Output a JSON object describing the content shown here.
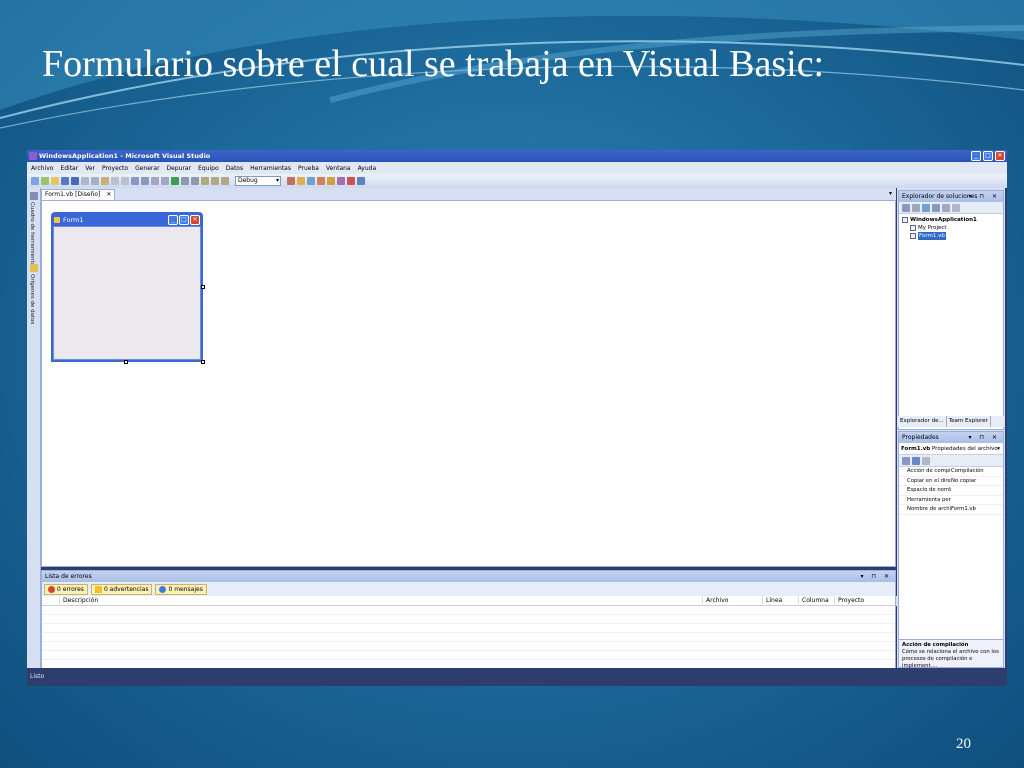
{
  "slide": {
    "title": "Formulario sobre el cual se trabaja en Visual Basic:",
    "page_number": "20"
  },
  "vs": {
    "window_title": "WindowsApplication1 - Microsoft Visual Studio",
    "window_buttons": [
      "_",
      "□",
      "✕"
    ],
    "menu": [
      "Archivo",
      "Editar",
      "Ver",
      "Proyecto",
      "Generar",
      "Depurar",
      "Equipo",
      "Datos",
      "Herramientas",
      "Prueba",
      "Ventana",
      "Ayuda"
    ],
    "config_value": "Debug",
    "left_strip": {
      "toolbox": "Cuadro de herramientas",
      "datasources": "Orígenes de datos"
    },
    "doc_tab": {
      "label": "Form1.vb [Diseño]",
      "close": "✕"
    },
    "form": {
      "title": "Form1"
    },
    "error_list": {
      "title": "Lista de errores",
      "controls": "▾ ⊓ ✕",
      "filters": [
        "0 errores",
        "0 advertencias",
        "0 mensajes"
      ],
      "columns": [
        "",
        "Descripción",
        "Archivo",
        "Línea",
        "Columna",
        "Proyecto"
      ]
    },
    "solution_explorer": {
      "title": "Explorador de soluciones",
      "controls": "▾ ⊓ ✕",
      "items": [
        "WindowsApplication1",
        "My Project",
        "Form1.vb"
      ],
      "tabs": [
        "Explorador de...",
        "Team Explorer"
      ]
    },
    "properties": {
      "title": "Propiedades",
      "controls": "▾ ⊓ ✕",
      "object_name": "Form1.vb",
      "object_type": "Propiedades del archivo",
      "rows": [
        {
          "name": "Acción de compil",
          "value": "Compilación"
        },
        {
          "name": "Copiar en el dire",
          "value": "No copiar"
        },
        {
          "name": "Espacio de nomb",
          "value": ""
        },
        {
          "name": "Herramienta per",
          "value": ""
        },
        {
          "name": "Nombre de archi",
          "value": "Form1.vb"
        }
      ],
      "desc_title": "Acción de compilación",
      "desc_text": "Cómo se relaciona el archivo con los procesos de compilación e implement...."
    },
    "status": "Listo"
  },
  "colors": {
    "accent": "#2653b8",
    "slide_bg": "#1d6c9d",
    "error": "#d2472c",
    "warning": "#f0c030",
    "info": "#3d7be0"
  }
}
